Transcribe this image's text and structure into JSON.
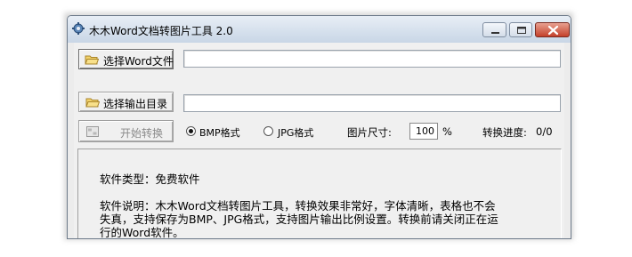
{
  "window": {
    "title": "木木Word文档转图片工具 2.0"
  },
  "toolbar": {
    "select_word_label": "选择Word文件",
    "select_output_label": "选择输出目录",
    "start_label": "开始转换",
    "word_path_value": "",
    "output_path_value": ""
  },
  "options": {
    "bmp_label": "BMP格式",
    "jpg_label": "JPG格式",
    "selected_format": "BMP",
    "size_label": "图片尺寸:",
    "size_value": "100",
    "size_unit": "%",
    "progress_label": "转换进度:",
    "progress_value": "0/0"
  },
  "info": {
    "type_line": "软件类型：免费软件",
    "desc_line1": "软件说明：木木Word文档转图片工具，转换效果非常好，字体清晰，表格也不会",
    "desc_line2": "失真，支持保存为BMP、JPG格式，支持图片输出比例设置。转换前请关闭正在运",
    "desc_line3": "行的Word软件。"
  },
  "icons": {
    "app": "gear-icon",
    "folder": "folder-icon",
    "start": "convert-icon",
    "minimize": "minimize-icon",
    "maximize": "maximize-icon",
    "close": "close-icon"
  },
  "colors": {
    "close_button": "#c4412b",
    "titlebar": "#d8e2ee",
    "window_bg": "#f0f0f0"
  }
}
